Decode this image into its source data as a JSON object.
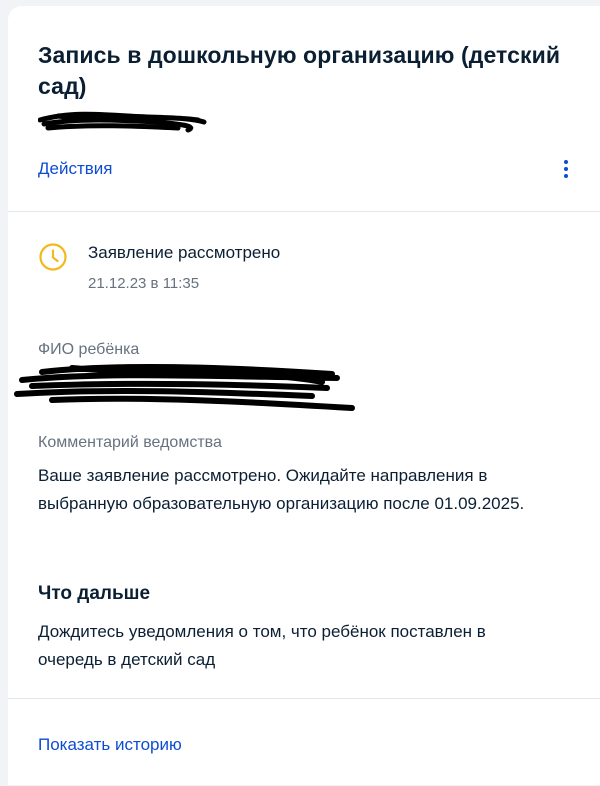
{
  "card": {
    "title": "Запись в дошкольную организацию (детский сад)",
    "actions_label": "Действия",
    "menu_icon": "more-vertical-icon"
  },
  "status": {
    "icon": "clock-icon",
    "title": "Заявление рассмотрено",
    "date": "21.12.23 в 11:35"
  },
  "child": {
    "label": "ФИО ребёнка"
  },
  "comment": {
    "label": "Комментарий ведомства",
    "text": "Ваше заявление рассмотрено. Ожидайте направления в выбранную образовательную организацию после 01.09.2025."
  },
  "next": {
    "title": "Что дальше",
    "text": "Дождитесь уведомления о том, что ребёнок поставлен в очередь в детский сад"
  },
  "footer": {
    "history_label": "Показать историю"
  },
  "colors": {
    "accent": "#0d4cd3",
    "status_icon": "#f2b91d",
    "muted_text": "#66727f",
    "text": "#0b1f33"
  }
}
